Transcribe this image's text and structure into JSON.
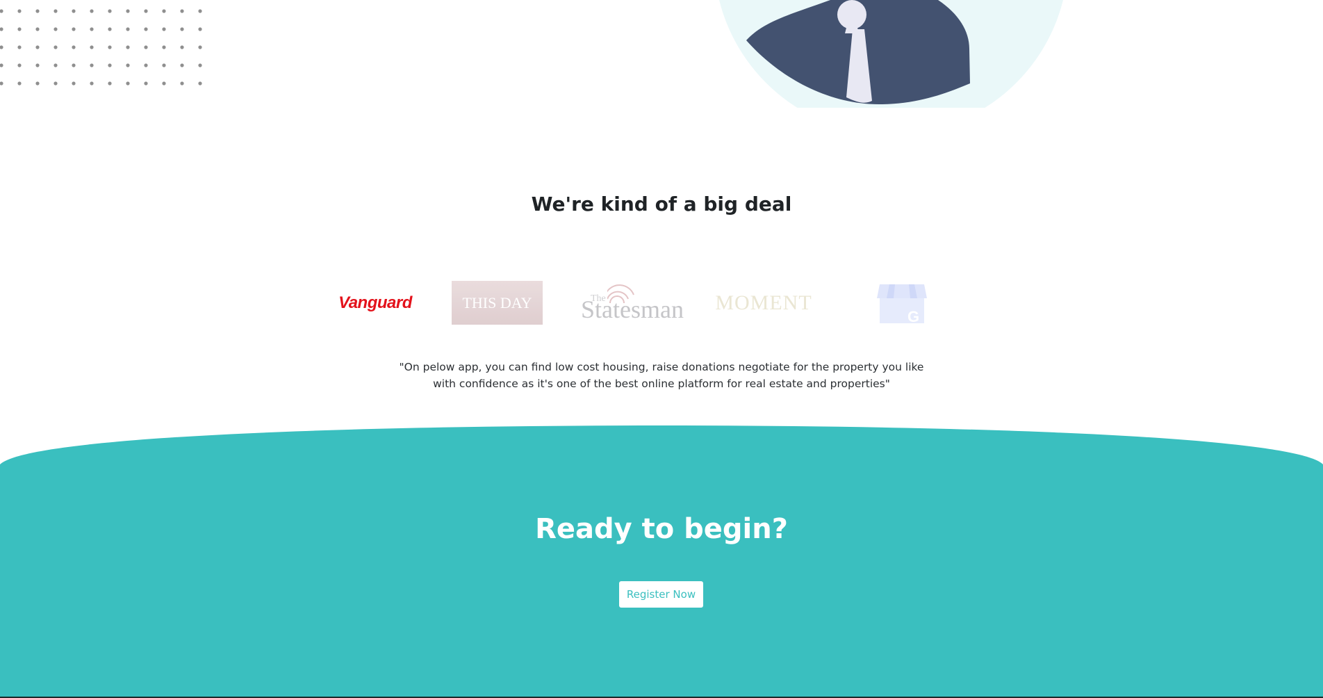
{
  "section_brands": {
    "heading": "We're kind of a big deal",
    "logos": [
      {
        "name": "Vanguard",
        "text": "Vanguard",
        "color": "#e3121b"
      },
      {
        "name": "ThisDay",
        "text": "THIS DAY"
      },
      {
        "name": "The Statesman",
        "prefix": "The",
        "text": "Statesman"
      },
      {
        "name": "Moment",
        "text": "MOMENT"
      },
      {
        "name": "Google My Business",
        "icon": "google-store-icon"
      }
    ],
    "quote_line_1": "\"On pelow app, you can find low cost housing, raise donations negotiate for the property you like",
    "quote_line_2": "with confidence as it's one of the best online platform for real estate and properties\""
  },
  "cta": {
    "heading": "Ready to begin?",
    "button_label": "Register Now"
  },
  "colors": {
    "teal": "#3abfbf",
    "avatar_suit": "#435270",
    "avatar_bg": "#eaf8f9"
  }
}
